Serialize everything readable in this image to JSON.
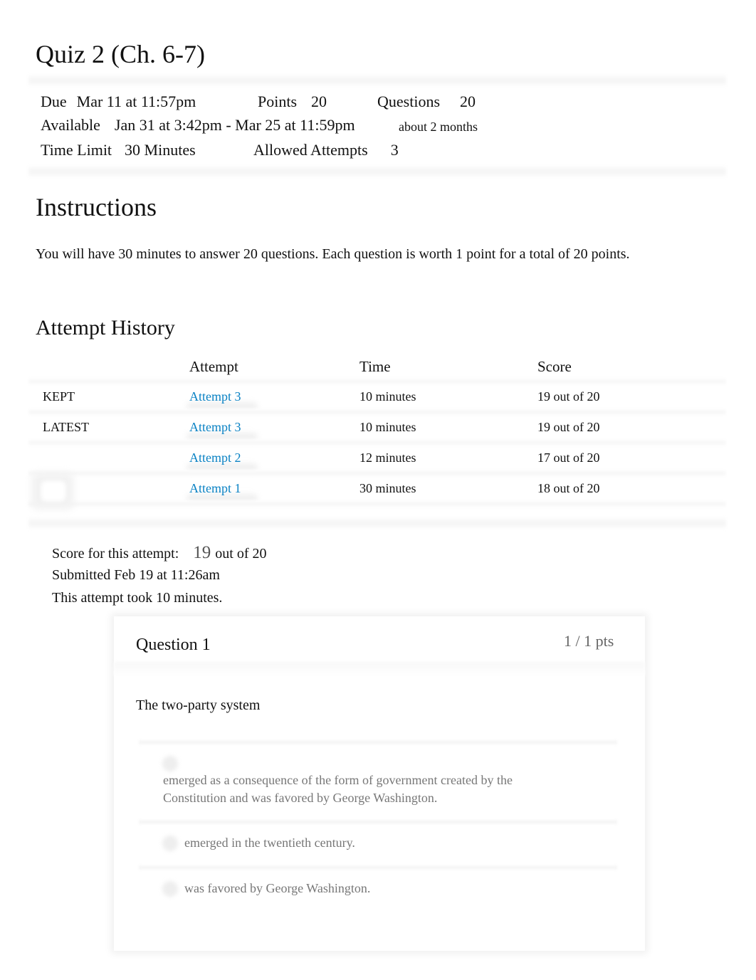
{
  "page": {
    "title": "Quiz 2 (Ch. 6-7)"
  },
  "details": {
    "due_label": "Due",
    "due_value": "Mar 11 at 11:57pm",
    "points_label": "Points",
    "points_value": "20",
    "questions_label": "Questions",
    "questions_value": "20",
    "available_label": "Available",
    "available_value": "Jan 31 at 3:42pm - Mar 25 at 11:59pm",
    "available_duration": "about 2 months",
    "time_limit_label": "Time Limit",
    "time_limit_value": "30 Minutes",
    "allowed_attempts_label": "Allowed Attempts",
    "allowed_attempts_value": "3"
  },
  "instructions": {
    "heading": "Instructions",
    "text": "You will have 30 minutes to answer 20 questions. Each question is worth 1 point for a total of 20 points."
  },
  "attempt_history": {
    "heading": "Attempt History",
    "columns": [
      "",
      "Attempt",
      "Time",
      "Score"
    ],
    "rows": [
      {
        "tag": "KEPT",
        "attempt": "Attempt 3",
        "time": "10 minutes",
        "score": "19 out of 20"
      },
      {
        "tag": "LATEST",
        "attempt": "Attempt 3",
        "time": "10 minutes",
        "score": "19 out of 20"
      },
      {
        "tag": "",
        "attempt": "Attempt 2",
        "time": "12 minutes",
        "score": "17 out of 20"
      },
      {
        "tag": "",
        "attempt": "Attempt 1",
        "time": "30 minutes",
        "score": "18 out of 20"
      }
    ]
  },
  "attempt_summary": {
    "score_label": "Score for this attempt:",
    "score_value": "19",
    "score_total": "out of 20",
    "submitted": "Submitted Feb 19 at 11:26am",
    "duration": "This attempt took 10 minutes."
  },
  "question": {
    "title": "Question 1",
    "points": "1 / 1 pts",
    "text": "The two-party system",
    "answers": [
      {
        "line1": "emerged as a consequence of the form of government created by the",
        "line2": "Constitution and was favored by George Washington."
      },
      {
        "line1": "emerged in the twentieth century.",
        "line2": ""
      },
      {
        "line1": "was favored by George Washington.",
        "line2": ""
      }
    ]
  },
  "colors": {
    "link": "#0a82c4",
    "muted_text": "#777777",
    "points_text": "#666666"
  }
}
